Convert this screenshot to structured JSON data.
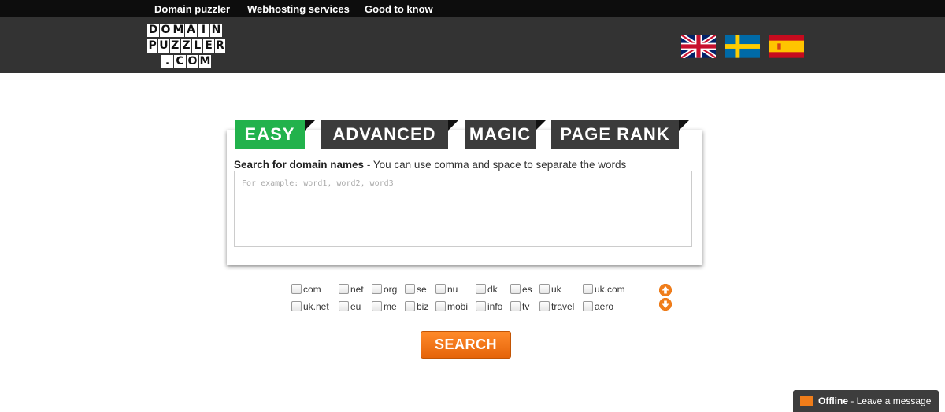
{
  "topnav": {
    "items": [
      "Domain puzzler",
      "Webhosting services",
      "Good to know"
    ]
  },
  "logo": {
    "rows": [
      "DOMAIN",
      "PUZZLER",
      ".COM"
    ]
  },
  "languages": [
    "English",
    "Swedish",
    "Spanish"
  ],
  "tabs": {
    "easy": "EASY",
    "advanced": "ADVANCED",
    "magic": "MAGIC",
    "pagerank": "PAGE RANK",
    "active_color": "#22b24c",
    "inactive_color": "#3b3b3b"
  },
  "search": {
    "label_bold": "Search for domain names",
    "label_rest": " - You can use comma and space to separate the words",
    "placeholder": "For example: word1, word2, word3",
    "button": "SEARCH"
  },
  "tlds": [
    [
      "com",
      "net",
      "org",
      "se",
      "nu",
      "dk",
      "es",
      "uk",
      "uk.com"
    ],
    [
      "uk.net",
      "eu",
      "me",
      "biz",
      "mobi",
      "info",
      "tv",
      "travel",
      "aero"
    ]
  ],
  "chat": {
    "status": "Offline",
    "message": " - Leave a message"
  },
  "colors": {
    "accent": "#f07d1a",
    "header": "#333333",
    "topbar": "#0d0d0d"
  }
}
